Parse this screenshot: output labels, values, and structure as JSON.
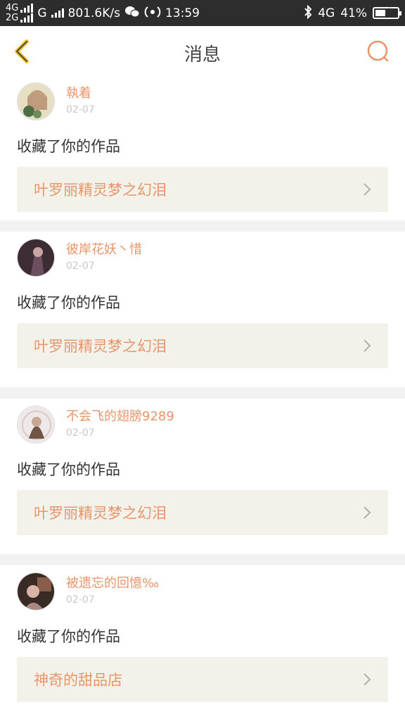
{
  "status_bar": {
    "net_top": "4G",
    "net_bottom": "2G",
    "net_g": "G",
    "speed": "801.6K/s",
    "hotspot": "(₂̶)",
    "time": "13:59",
    "network_right": "4G",
    "battery_percent": "41%"
  },
  "header": {
    "title": "消息"
  },
  "notifications": [
    {
      "username": "執着",
      "date": "02-07",
      "action": "收藏了你的作品",
      "work_title": "叶罗丽精灵梦之幻泪",
      "avatar_colors": [
        "#e7dfc4",
        "#b48a6a",
        "#4c6f45"
      ]
    },
    {
      "username": "彼岸花妖丶惜",
      "date": "02-07",
      "action": "收藏了你的作品",
      "work_title": "叶罗丽精灵梦之幻泪",
      "avatar_colors": [
        "#3b2d33",
        "#c9a5a1",
        "#6b4f5e"
      ]
    },
    {
      "username": "不会飞的翅膀9289",
      "date": "02-07",
      "action": "收藏了你的作品",
      "work_title": "叶罗丽精灵梦之幻泪",
      "avatar_colors": [
        "#efe8e8",
        "#6e5544",
        "#c8a694"
      ]
    },
    {
      "username": "被遗忘的回憶‰",
      "date": "02-07",
      "action": "收藏了你的作品",
      "work_title": "神奇的甜品店",
      "avatar_colors": [
        "#3a2a26",
        "#d8b3a7",
        "#8a5c4a"
      ]
    }
  ],
  "colors": {
    "accent": "#e8956a",
    "back_arrow": "#f3c323",
    "status_bar_bg": "#2d2d2d",
    "link_bg": "#f2f2ea"
  }
}
